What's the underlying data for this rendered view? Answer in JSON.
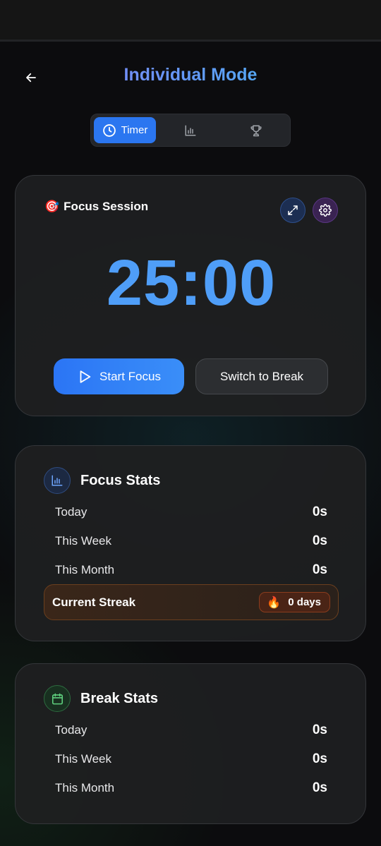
{
  "header": {
    "title": "Individual Mode"
  },
  "tabs": {
    "timer_label": "Timer"
  },
  "timer": {
    "session_title": "Focus Session",
    "session_emoji": "🎯",
    "time": "25:00",
    "start_label": "Start Focus",
    "switch_label": "Switch to Break"
  },
  "focus_stats": {
    "title": "Focus Stats",
    "rows": [
      {
        "label": "Today",
        "value": "0s"
      },
      {
        "label": "This Week",
        "value": "0s"
      },
      {
        "label": "This Month",
        "value": "0s"
      }
    ],
    "streak_label": "Current Streak",
    "streak_emoji": "🔥",
    "streak_value": "0 days"
  },
  "break_stats": {
    "title": "Break Stats",
    "rows": [
      {
        "label": "Today",
        "value": "0s"
      },
      {
        "label": "This Week",
        "value": "0s"
      },
      {
        "label": "This Month",
        "value": "0s"
      }
    ]
  },
  "icons": {
    "back": "arrow-left-icon",
    "timer_tab": "clock-icon",
    "stats_tab": "bar-chart-icon",
    "achievements_tab": "trophy-icon",
    "expand": "expand-icon",
    "settings": "gear-icon",
    "play": "play-icon",
    "focus_stats": "bar-chart-icon",
    "break_stats": "calendar-icon"
  },
  "colors": {
    "accent": "#2b76f0",
    "timer_digits": "#4f9ef8",
    "title_gradient_start": "#8b7cf6",
    "title_gradient_end": "#3ec1e6",
    "streak_orange": "#8a3c1d"
  }
}
